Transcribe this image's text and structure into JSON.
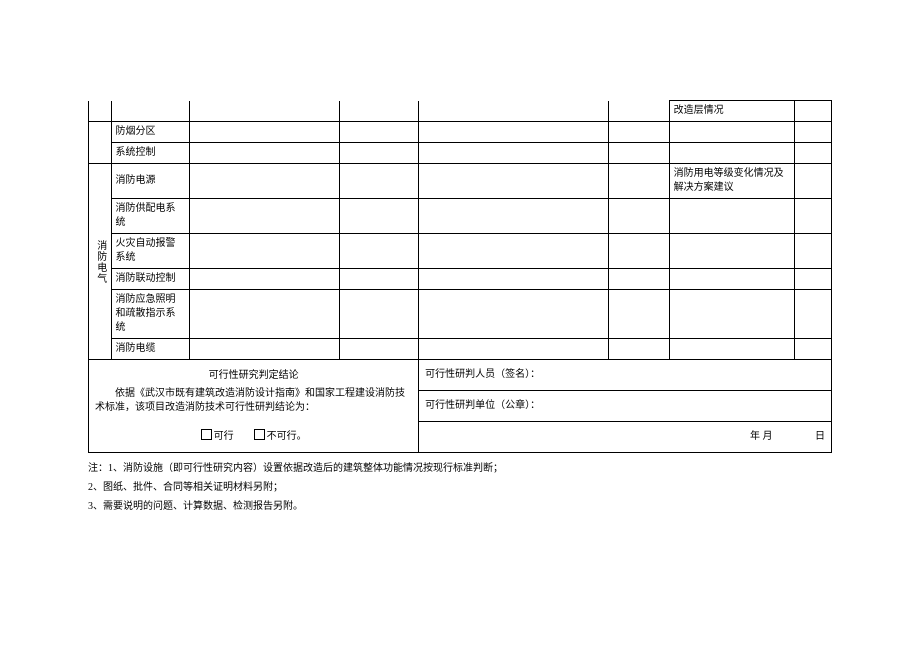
{
  "section_label": "消防电气",
  "rows": {
    "gzc": "改造层情况",
    "fyfq": "防烟分区",
    "xtkz": "系统控制",
    "xfdy": "消防电源",
    "xfdy_note": "消防用电等级变化情况及解决方案建议",
    "xfgpd": "消防供配电系统",
    "hzbj": "火灾自动报警系统",
    "xfld": "消防联动控制",
    "yjzm": "消防应急照明和疏散指示系统",
    "xfdl": "消防电缆"
  },
  "conclusion": {
    "title": "可行性研究判定结论",
    "body": "依据《武汉市既有建筑改造消防设计指南》和国家工程建设消防技术标准，该项目改造消防技术可行性研判结论为：",
    "opt_yes": "可行",
    "opt_no": "不可行。"
  },
  "right": {
    "signer": "可行性研判人员（签名）：",
    "unit": "可行性研判单位（公章）：",
    "date_ym": "年 月",
    "date_d": "日"
  },
  "footnotes": {
    "f1": "注：1、消防设施（即可行性研究内容）设置依据改造后的建筑整体功能情况按现行标准判断；",
    "f2": "2、图纸、批件、合同等相关证明材料另附；",
    "f3": "3、需要说明的问题、计算数据、检测报告另附。"
  }
}
